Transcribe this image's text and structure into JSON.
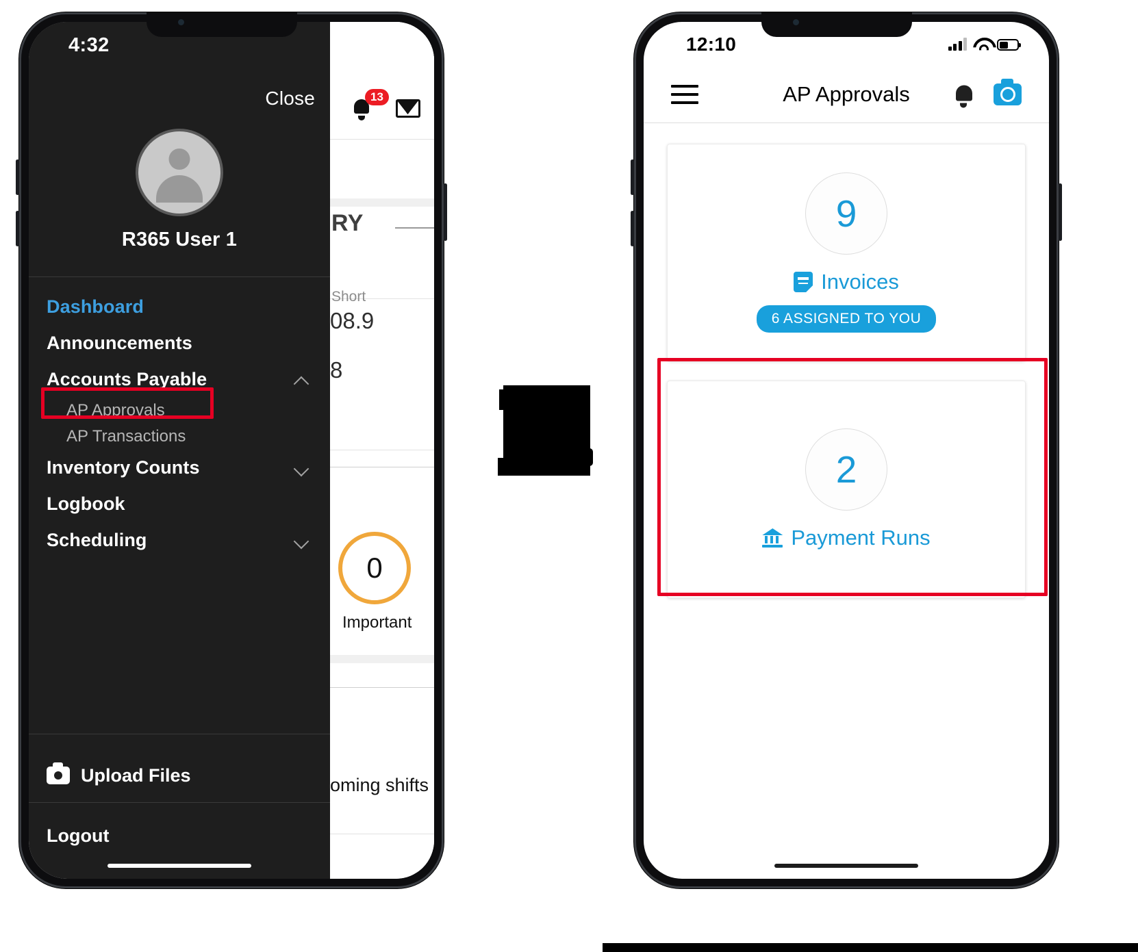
{
  "left_phone": {
    "status_bar": {
      "time": "4:32"
    },
    "drawer": {
      "close_label": "Close",
      "profile": {
        "name": "R365 User 1",
        "avatar_icon": "person-icon"
      },
      "nav_items": [
        {
          "label": "Dashboard",
          "active": true,
          "chevron": "none"
        },
        {
          "label": "Announcements",
          "active": false,
          "chevron": "none"
        },
        {
          "label": "Accounts Payable",
          "active": false,
          "chevron": "chevron-up-icon"
        },
        {
          "label": "Inventory Counts",
          "active": false,
          "chevron": "chevron-down-icon"
        },
        {
          "label": "Logbook",
          "active": false,
          "chevron": "none"
        },
        {
          "label": "Scheduling",
          "active": false,
          "chevron": "chevron-down-icon"
        }
      ],
      "sub_items": [
        {
          "label": "AP Approvals",
          "highlighted": true
        },
        {
          "label": "AP Transactions",
          "highlighted": false
        }
      ],
      "upload_files_label": "Upload Files",
      "upload_icon": "camera-icon",
      "logout_label": "Logout"
    },
    "background_dashboard": {
      "notification_badge": "13",
      "bell_icon": "bell-icon",
      "mail_icon": "envelope-icon",
      "partial_heading": "RY",
      "partial_label_short": "Short",
      "partial_value_1": "08.9",
      "partial_value_2": "8",
      "important_count": "0",
      "important_label": "Important",
      "partial_shifts_text": "oming shifts"
    }
  },
  "right_phone": {
    "status_bar": {
      "time": "12:10",
      "signal_icon": "cellular-signal-icon",
      "wifi_icon": "wifi-icon",
      "battery_icon": "battery-icon"
    },
    "app_bar": {
      "menu_icon": "hamburger-menu-icon",
      "title": "AP Approvals",
      "bell_icon": "bell-icon",
      "camera_icon": "camera-icon"
    },
    "cards": [
      {
        "count": "9",
        "label": "Invoices",
        "icon": "invoice-document-icon",
        "pill": "6 ASSIGNED TO YOU",
        "highlighted": false
      },
      {
        "count": "2",
        "label": "Payment Runs",
        "icon": "bank-building-icon",
        "pill": null,
        "highlighted": true
      }
    ]
  },
  "annotation": {
    "highlight_color": "#e60023",
    "arrow_block": "black-arrow-block"
  },
  "colors": {
    "accent_blue": "#19a0dc",
    "drawer_bg": "#1e1e1e",
    "active_nav": "#3d9fe0",
    "badge_red": "#ec1c24",
    "important_ring": "#f0a73b"
  }
}
